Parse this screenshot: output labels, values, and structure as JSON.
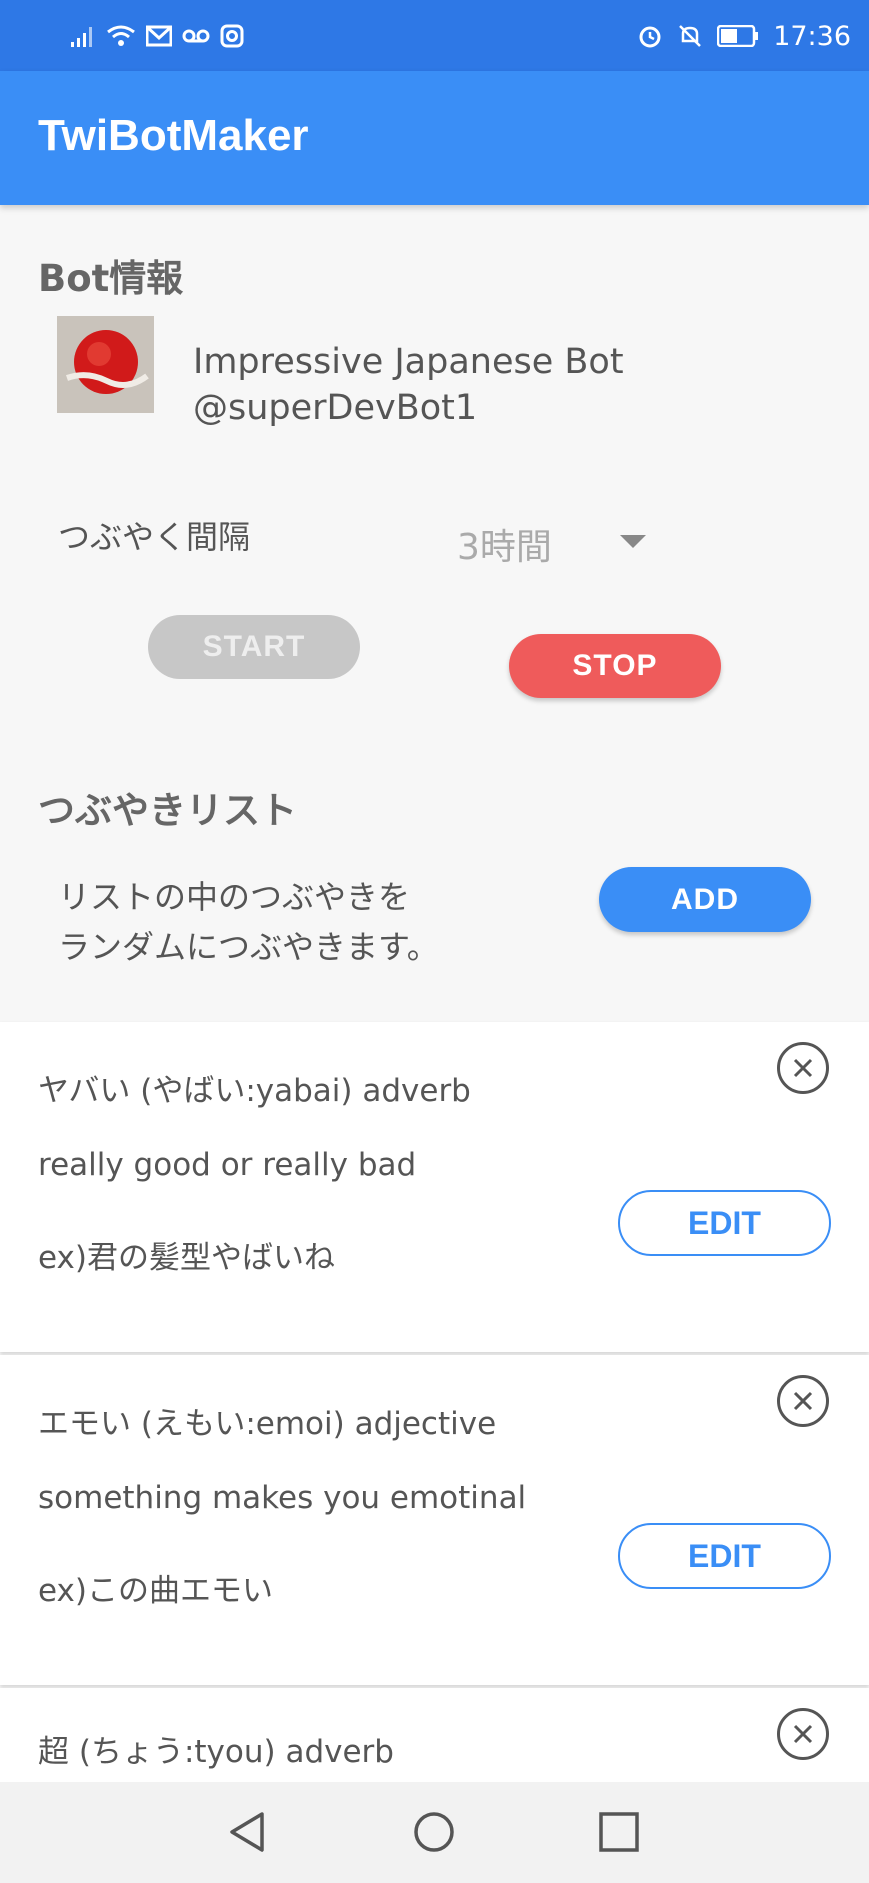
{
  "status_bar": {
    "time": "17:36",
    "icons_left": [
      "signal-icon",
      "wifi-icon",
      "mail-icon",
      "voicemail-icon",
      "instagram-icon"
    ],
    "icons_right": [
      "alarm-icon",
      "mute-icon",
      "battery-icon"
    ]
  },
  "app_bar": {
    "title": "TwiBotMaker",
    "color": "#3a8ef6"
  },
  "bot_info": {
    "section_title": "Bot情報",
    "name": "Impressive Japanese Bot",
    "handle": "@superDevBot1"
  },
  "interval": {
    "label": "つぶやく間隔",
    "value": "3時間"
  },
  "controls": {
    "start_label": "START",
    "stop_label": "STOP",
    "stop_color": "#ef5b5b"
  },
  "tweet_list": {
    "section_title": "つぶやきリスト",
    "description_line1": "リストの中のつぶやきを",
    "description_line2": "ランダムにつぶやきます。",
    "add_label": "ADD",
    "items": [
      {
        "line1": "ヤバい (やばい:yabai) adverb",
        "line2": "really good or really bad",
        "line3": "ex)君の髪型やばいね",
        "edit_label": "EDIT"
      },
      {
        "line1": "エモい (えもい:emoi) adjective",
        "line2": "something makes you emotinal",
        "line3": "ex)この曲エモい",
        "edit_label": "EDIT"
      },
      {
        "line1": "超 (ちょう:tyou) adverb"
      }
    ]
  },
  "nav_bar": {
    "icons": [
      "back-icon",
      "home-icon",
      "recents-icon"
    ]
  }
}
